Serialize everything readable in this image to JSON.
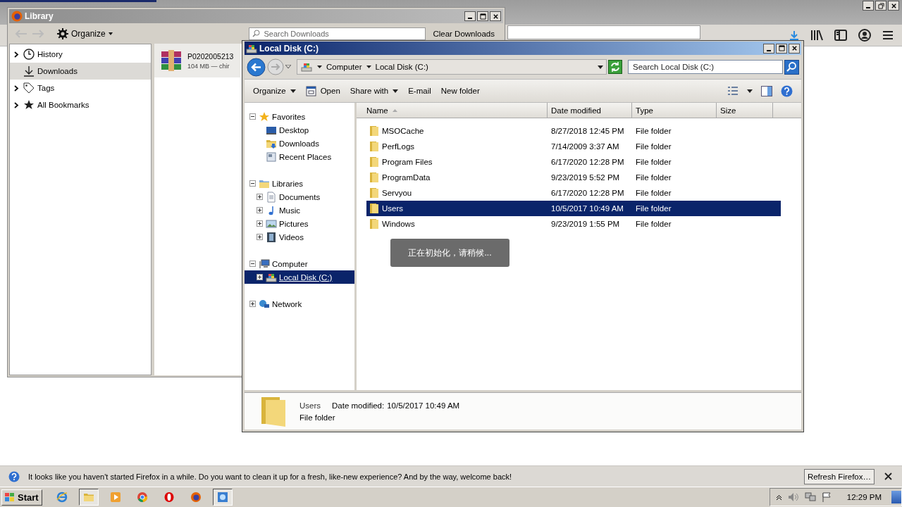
{
  "browser": {
    "notification": {
      "message": "It looks like you haven't started Firefox in a while. Do you want to clean it up for a fresh, like-new experience? And by the way, welcome back!",
      "button": "Refresh Firefox…"
    }
  },
  "library": {
    "title": "Library",
    "organize": "Organize",
    "search": {
      "placeholder": "Search Downloads"
    },
    "clear_button": "Clear Downloads",
    "sidebar": [
      {
        "label": "History",
        "selected": false,
        "expanded": false
      },
      {
        "label": "Downloads",
        "selected": true
      },
      {
        "label": "Tags",
        "selected": false,
        "expanded": false
      },
      {
        "label": "All Bookmarks",
        "selected": false,
        "expanded": false
      }
    ],
    "downloads": [
      {
        "name": "P0202005213",
        "detail": "104 MB — chir"
      }
    ]
  },
  "explorer": {
    "title": "Local Disk (C:)",
    "breadcrumb": [
      "Computer",
      "Local Disk (C:)"
    ],
    "search": {
      "placeholder": "Search Local Disk (C:)"
    },
    "toolbar": [
      {
        "label": "Organize",
        "dropdown": true
      },
      {
        "label": "Open",
        "dropdown": false
      },
      {
        "label": "Share with",
        "dropdown": true
      },
      {
        "label": "E-mail",
        "dropdown": false
      },
      {
        "label": "New folder",
        "dropdown": false
      }
    ],
    "nav": [
      {
        "label": "Favorites",
        "expanded": true,
        "selected": false,
        "children": [
          {
            "label": "Desktop",
            "selected": false
          },
          {
            "label": "Downloads",
            "selected": false
          },
          {
            "label": "Recent Places",
            "selected": false
          }
        ]
      },
      {
        "label": "Libraries",
        "expanded": true,
        "selected": false,
        "children": [
          {
            "label": "Documents",
            "expanded": false,
            "selected": false
          },
          {
            "label": "Music",
            "expanded": false,
            "selected": false
          },
          {
            "label": "Pictures",
            "expanded": false,
            "selected": false
          },
          {
            "label": "Videos",
            "expanded": false,
            "selected": false
          }
        ]
      },
      {
        "label": "Computer",
        "expanded": true,
        "selected": false,
        "children": [
          {
            "label": "Local Disk (C:)",
            "expanded": false,
            "selected": true
          }
        ]
      },
      {
        "label": "Network",
        "expanded": false,
        "selected": false
      }
    ],
    "columns": [
      {
        "label": "Name",
        "sorted": true
      },
      {
        "label": "Date modified",
        "sorted": false
      },
      {
        "label": "Type",
        "sorted": false
      },
      {
        "label": "Size",
        "sorted": false
      }
    ],
    "rows": [
      {
        "name": "MSOCache",
        "date": "8/27/2018 12:45 PM",
        "type": "File folder",
        "selected": false
      },
      {
        "name": "PerfLogs",
        "date": "7/14/2009 3:37 AM",
        "type": "File folder",
        "selected": false
      },
      {
        "name": "Program Files",
        "date": "6/17/2020 12:28 PM",
        "type": "File folder",
        "selected": false
      },
      {
        "name": "ProgramData",
        "date": "9/23/2019 5:52 PM",
        "type": "File folder",
        "selected": false
      },
      {
        "name": "Servyou",
        "date": "6/17/2020 12:28 PM",
        "type": "File folder",
        "selected": false
      },
      {
        "name": "Users",
        "date": "10/5/2017 10:49 AM",
        "type": "File folder",
        "selected": true
      },
      {
        "name": "Windows",
        "date": "9/23/2019 1:55 PM",
        "type": "File folder",
        "selected": false
      }
    ],
    "details": {
      "name": "Users",
      "date_label": "Date modified:",
      "date": "10/5/2017 10:49 AM",
      "type": "File folder"
    },
    "toast": "正在初始化，请稍候..."
  },
  "taskbar": {
    "start": "Start",
    "apps": [
      {
        "selected": false
      },
      {
        "selected": true
      },
      {
        "selected": false
      },
      {
        "selected": false
      },
      {
        "selected": false
      },
      {
        "selected": false
      },
      {
        "selected": true
      }
    ],
    "clock": "12:29 PM"
  }
}
